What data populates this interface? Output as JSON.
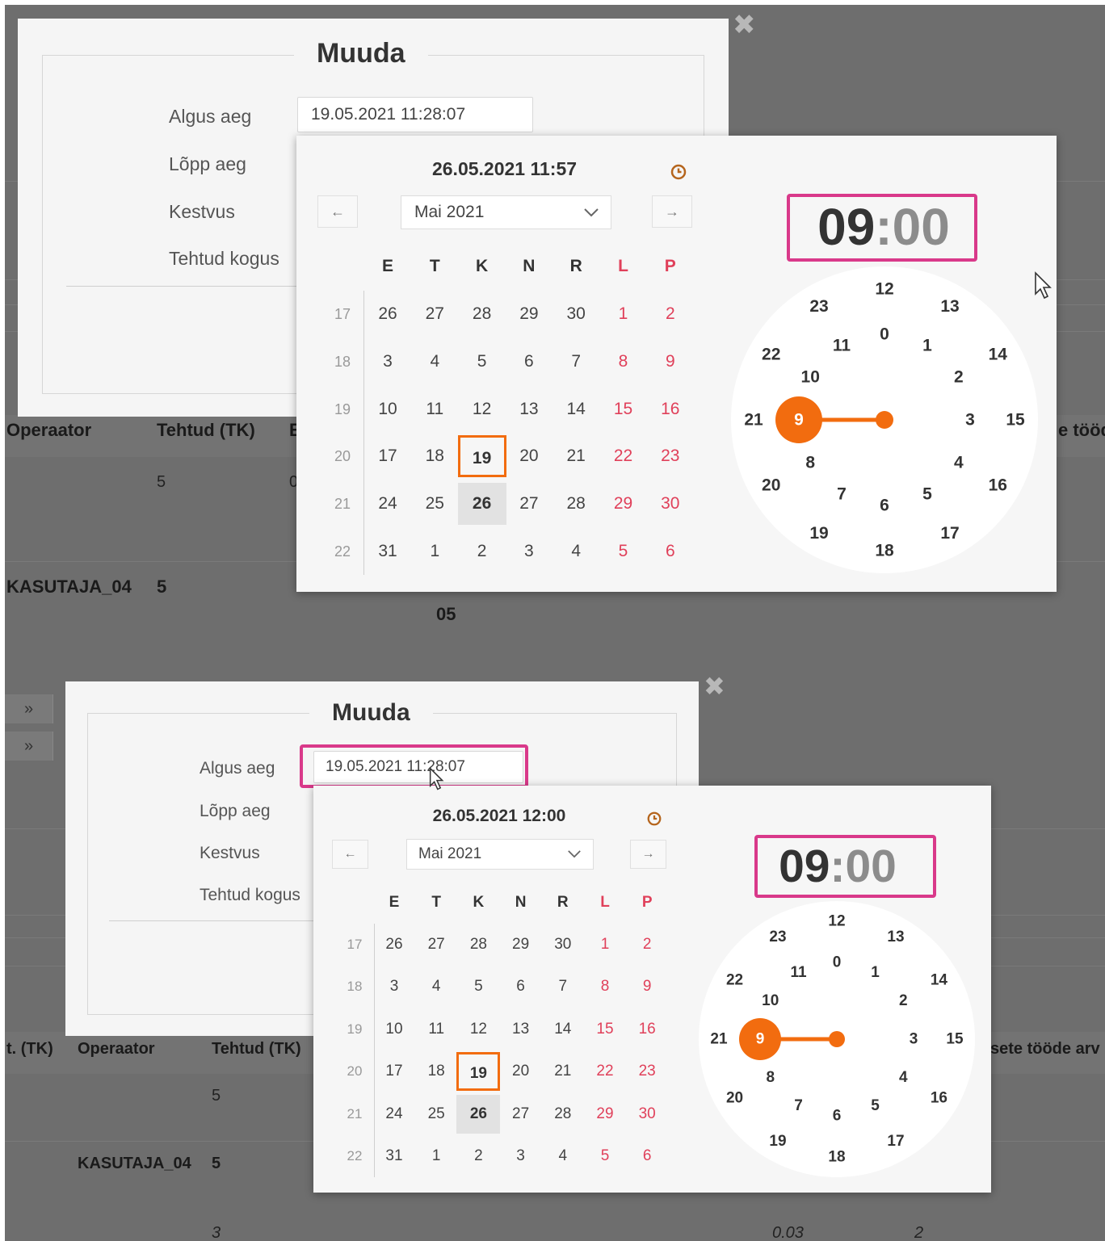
{
  "background": {
    "top": {
      "header_operaator": "Operaator",
      "header_tehtud": "Tehtud (TK)",
      "header_cut_b": "E",
      "header_right": "e tööd",
      "row1_value": "5",
      "row1_cut": "0",
      "row2_user": "KASUTAJA_04",
      "row2_value": "5",
      "row2_extra": "05"
    },
    "bottom": {
      "header_cut_left": "t. (TK)",
      "header_operaator": "Operaator",
      "header_tehtud": "Tehtud (TK)",
      "header_right": "sete tööde arv",
      "chevron": "»",
      "row1_value": "5",
      "row2_user": "KASUTAJA_04",
      "row2_value": "5",
      "row3_value": "3",
      "row3_mid": "0.03",
      "row3_right": "2"
    }
  },
  "dialog": {
    "title": "Muuda",
    "close_symbol": "✖",
    "labels": [
      "Algus aeg",
      "Lõpp aeg",
      "Kestvus",
      "Tehtud kogus"
    ],
    "algus_value": "19.05.2021 11:28:07"
  },
  "picker_top": {
    "title": "26.05.2021 11:57",
    "month_select": "Mai 2021",
    "prev": "←",
    "next": "→",
    "time_hours": "09",
    "time_sep": ":",
    "time_minutes": "00"
  },
  "picker_bottom": {
    "title": "26.05.2021 12:00",
    "month_select": "Mai 2021",
    "prev": "←",
    "next": "→",
    "time_hours": "09",
    "time_sep": ":",
    "time_minutes": "00"
  },
  "calendar": {
    "weekdays": [
      "E",
      "T",
      "K",
      "N",
      "R",
      "L",
      "P"
    ],
    "week_numbers": [
      "17",
      "18",
      "19",
      "20",
      "21",
      "22"
    ],
    "rows": [
      [
        "26",
        "27",
        "28",
        "29",
        "30",
        "1",
        "2"
      ],
      [
        "3",
        "4",
        "5",
        "6",
        "7",
        "8",
        "9"
      ],
      [
        "10",
        "11",
        "12",
        "13",
        "14",
        "15",
        "16"
      ],
      [
        "17",
        "18",
        "19",
        "20",
        "21",
        "22",
        "23"
      ],
      [
        "24",
        "25",
        "26",
        "27",
        "28",
        "29",
        "30"
      ],
      [
        "31",
        "1",
        "2",
        "3",
        "4",
        "5",
        "6"
      ]
    ],
    "selected_day": "19",
    "today_day": "26"
  },
  "clock": {
    "outer_hours": [
      "12",
      "13",
      "14",
      "15",
      "16",
      "17",
      "18",
      "19",
      "20",
      "21",
      "22",
      "23"
    ],
    "inner_hours": [
      "0",
      "1",
      "2",
      "3",
      "4",
      "5",
      "6",
      "7",
      "8",
      "9",
      "10",
      "11"
    ],
    "selected_hour": "9"
  },
  "colors": {
    "accent_orange": "#f26c0f",
    "highlight_pink": "#d9398a",
    "weekend_red": "#e0405a"
  }
}
